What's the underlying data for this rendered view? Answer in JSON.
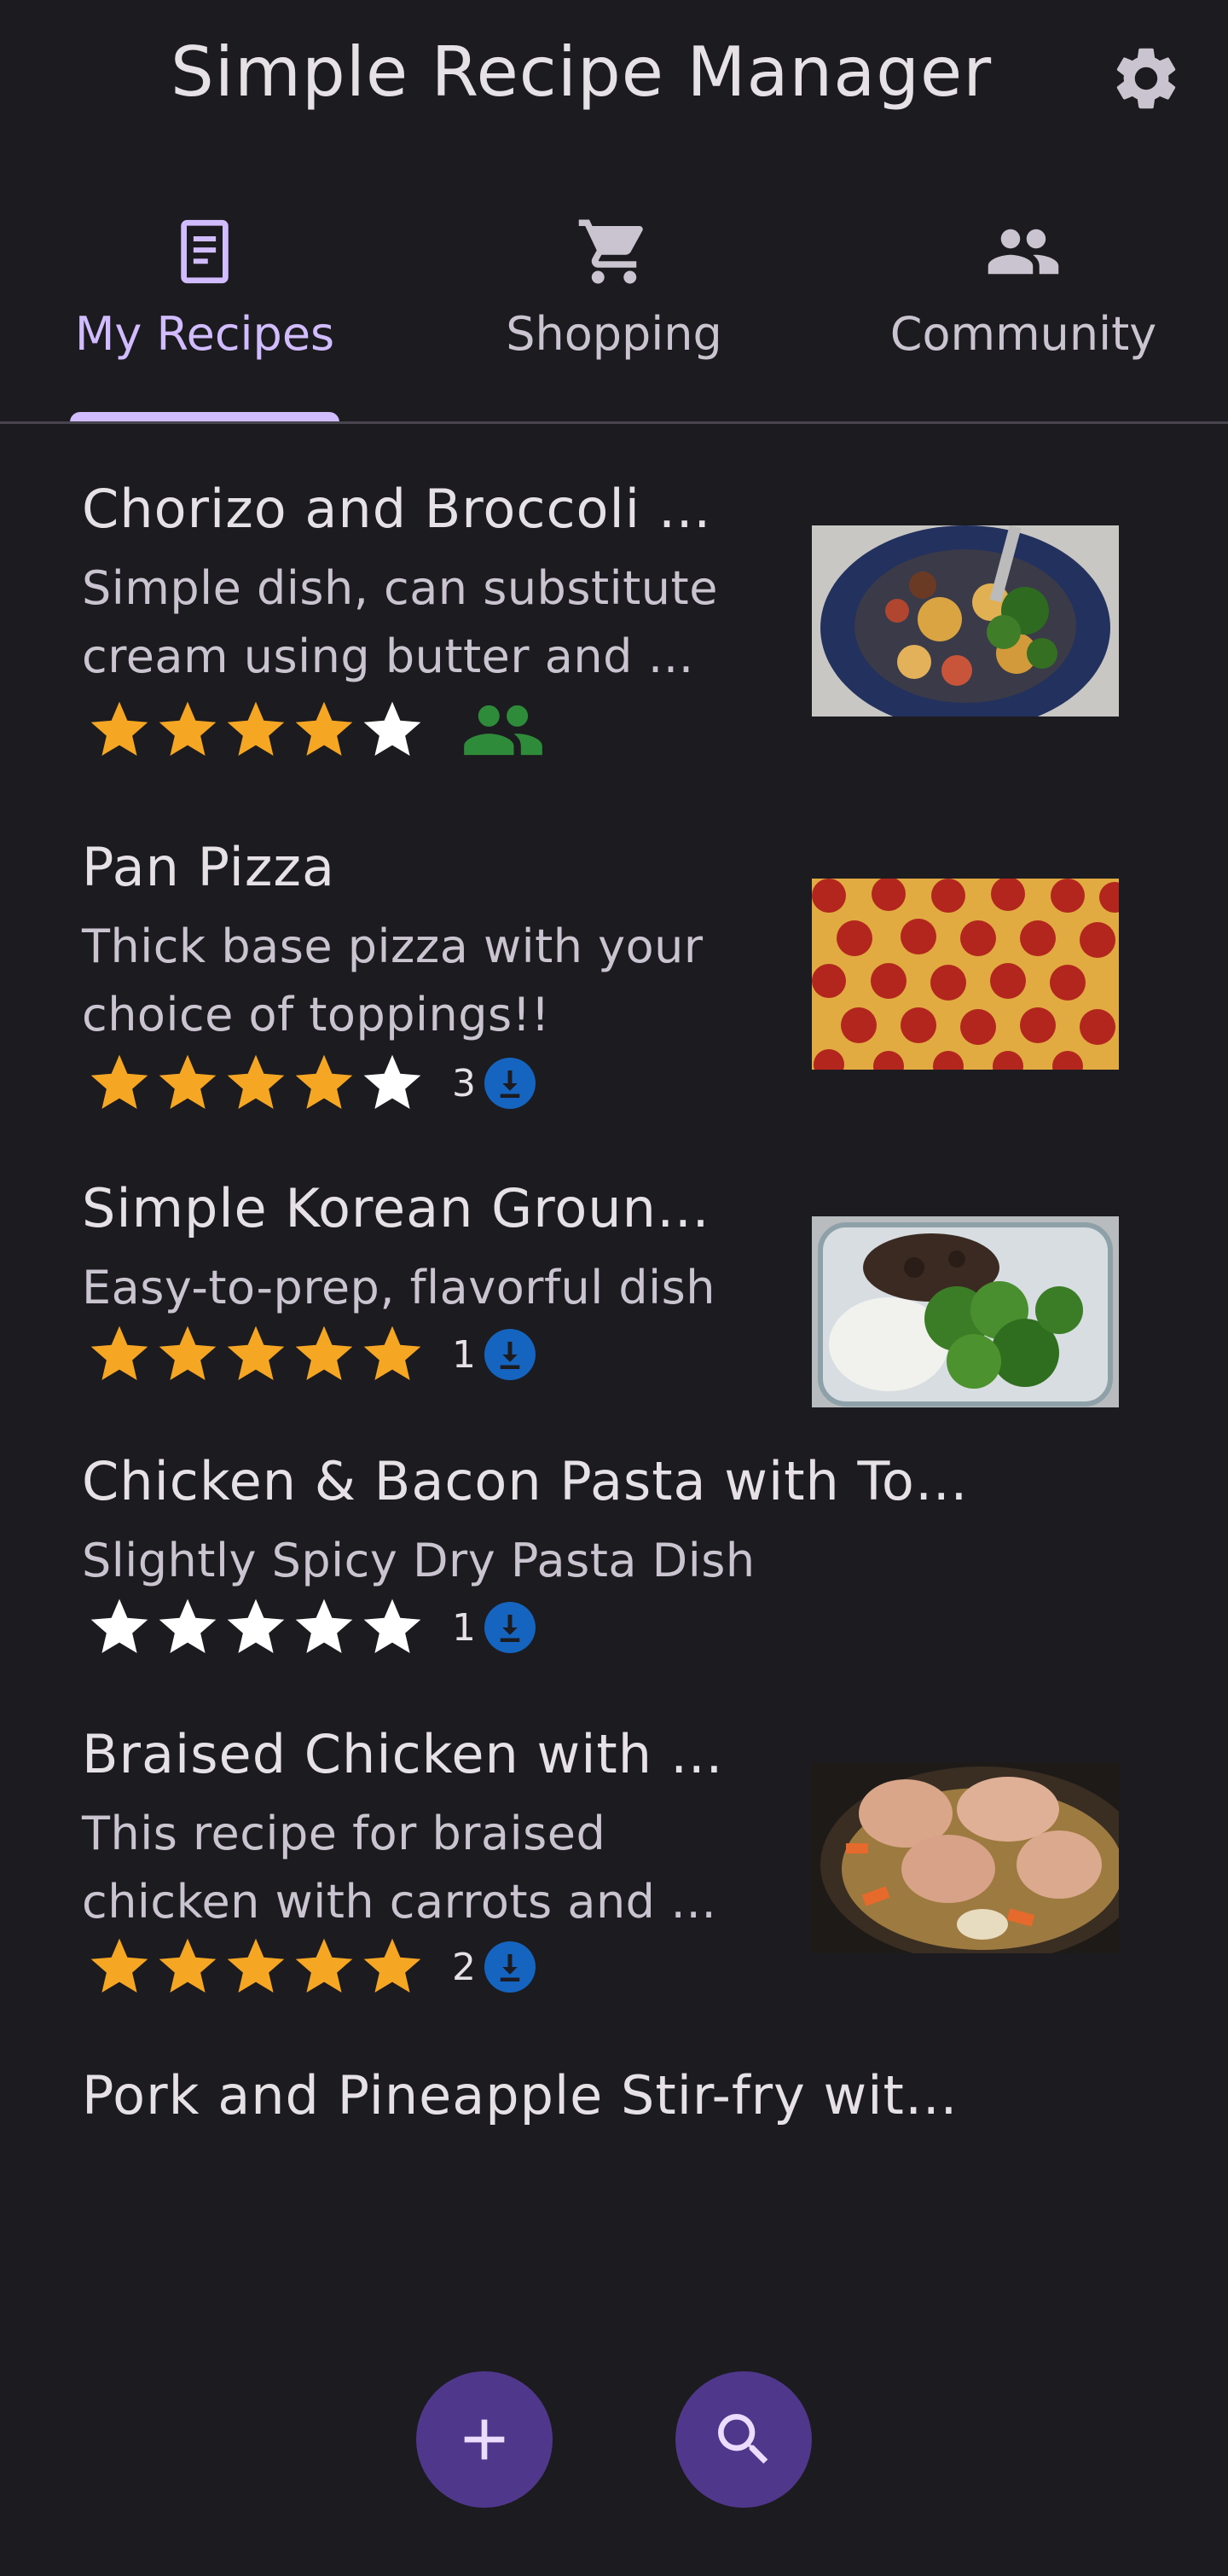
{
  "app": {
    "title": "Simple Recipe Manager"
  },
  "tabs": [
    {
      "label": "My Recipes",
      "icon": "recipe-document-icon",
      "active": true
    },
    {
      "label": "Shopping",
      "icon": "shopping-cart-icon",
      "active": false
    },
    {
      "label": "Community",
      "icon": "people-icon",
      "active": false
    }
  ],
  "recipes": [
    {
      "title": "Chorizo and Broccoli …",
      "description": "Simple dish, can substitute cream using butter and …",
      "stars": 4,
      "badge": "community-icon",
      "image": "pasta-bowl-photo"
    },
    {
      "title": "Pan Pizza",
      "description": "Thick base pizza with your choice of toppings!!",
      "stars": 4,
      "count": "3",
      "badge": "download-icon",
      "image": "pepperoni-pizza-photo"
    },
    {
      "title": "Simple Korean Groun…",
      "description": "Easy-to-prep, flavorful dish",
      "stars": 5,
      "count": "1",
      "badge": "download-icon",
      "image": "beef-broccoli-rice-photo"
    },
    {
      "title": "Chicken & Bacon Pasta with To…",
      "description": "Slightly Spicy Dry Pasta Dish",
      "stars": 0,
      "count": "1",
      "badge": "download-icon"
    },
    {
      "title": "Braised Chicken with …",
      "description": "This recipe for braised chicken with carrots and …",
      "stars": 5,
      "count": "2",
      "badge": "download-icon",
      "image": "braised-chicken-photo"
    },
    {
      "title": "Pork and Pineapple Stir-fry wit…"
    }
  ],
  "colors": {
    "background": "#1c1b1f",
    "accent": "#d0bcff",
    "star_filled": "#f5a623",
    "star_empty": "#ffffff",
    "community_badge": "#2e8b3a",
    "download_badge": "#1565c0",
    "fab": "#4f378b"
  },
  "fabs": [
    {
      "icon": "add-icon"
    },
    {
      "icon": "search-icon"
    }
  ]
}
